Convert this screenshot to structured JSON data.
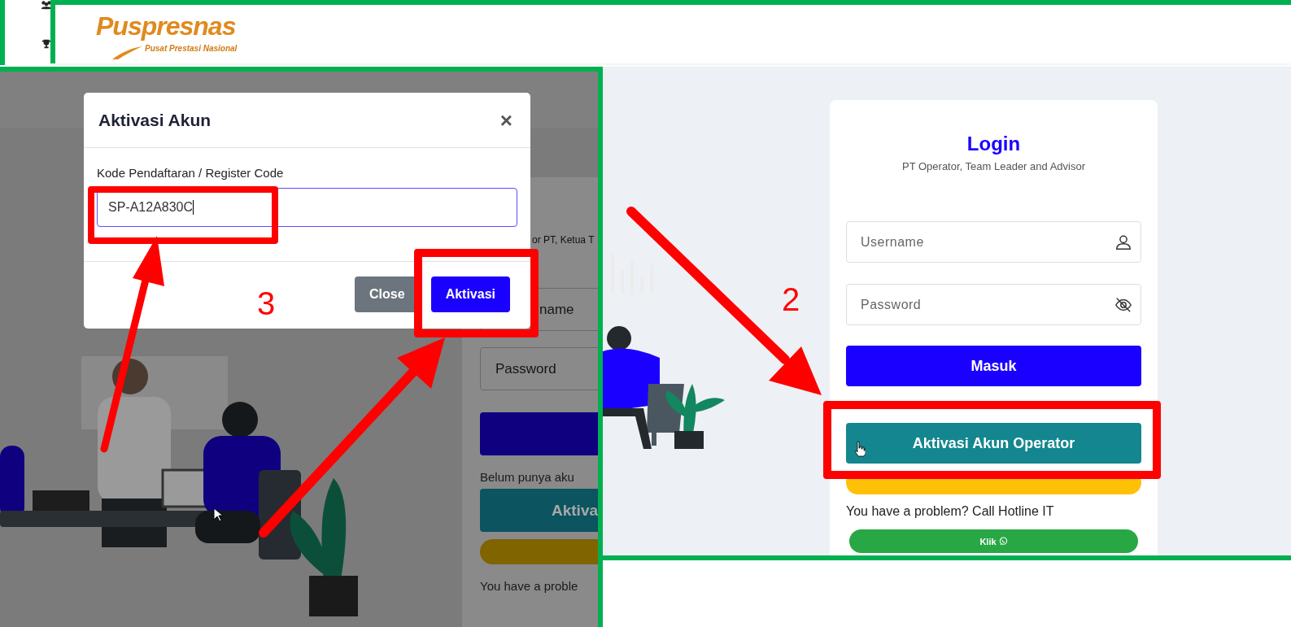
{
  "header": {
    "logo_title": "Puspresnas",
    "logo_subtitle": "Pusat Prestasi Nasional"
  },
  "left_panel": {
    "background_page": {
      "subtitle_fragment": "or PT, Ketua T",
      "fields": [
        {
          "placeholder": "name"
        },
        {
          "placeholder": "Password"
        }
      ],
      "register_prompt": "Belum punya aku",
      "activate_button": "Aktiva",
      "problem_text": "You have a proble"
    },
    "modal": {
      "title": "Aktivasi Akun",
      "close": "×",
      "field_label": "Kode Pendaftaran / Register Code",
      "field_value": "SP-A12A830C",
      "buttons": [
        {
          "label": "Close",
          "kind": "secondary"
        },
        {
          "label": "Aktivasi",
          "kind": "primary"
        }
      ]
    },
    "annotation": "3"
  },
  "right_panel": {
    "login": {
      "title": "Login",
      "subtitle": "PT Operator, Team Leader and Advisor",
      "fields": [
        {
          "placeholder": "Username",
          "kind": "user"
        },
        {
          "placeholder": "Password",
          "kind": "password"
        }
      ],
      "submit": "Masuk",
      "activate_button": "Aktivasi Akun Operator",
      "problem_text": "You have a problem? Call Hotline IT",
      "hotline_button": "Klik"
    },
    "annotation": "2"
  }
}
